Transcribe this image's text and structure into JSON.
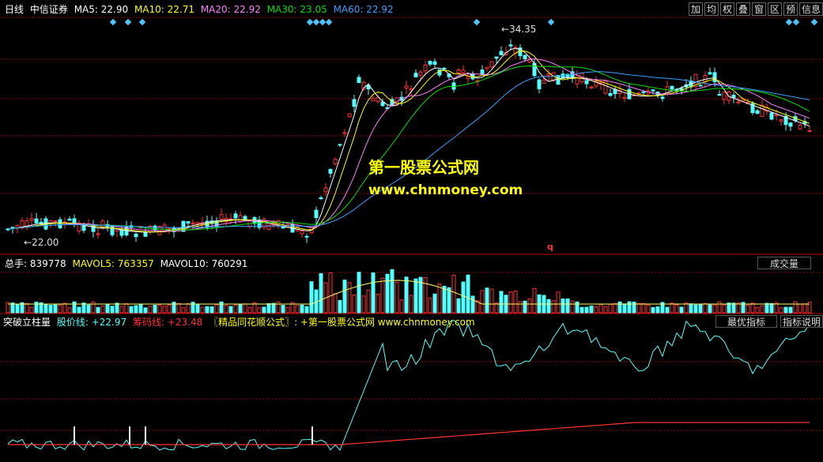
{
  "header": {
    "period": "日线",
    "stock": "中信证券",
    "ma5": "MA5: 22.90",
    "ma10": "MA10: 22.71",
    "ma20": "MA20: 22.92",
    "ma30": "MA30: 23.05",
    "ma60": "MA60: 22.92"
  },
  "toolbar": [
    "加",
    "均",
    "权",
    "叠",
    "窗",
    "区",
    "预",
    "信息"
  ],
  "annotations": {
    "high": "34.35",
    "low": "22.00",
    "marker": "q"
  },
  "watermark": {
    "line1": "第一股票公式网",
    "line2": "www.chnmoney.com"
  },
  "volume_panel": {
    "total": "总手: 839778",
    "mavol5": "MAVOL5: 763357",
    "mavol10": "MAVOL10: 760291",
    "button": "成交量"
  },
  "indicator_panel": {
    "name": "突破立柱量",
    "price_line": "股价线: +22.97",
    "chip_line": "筹码线: +23.48",
    "source": "〖精品同花顺公式〗: +第一股票公式网 www.chnmoney.com",
    "btn_best": "最优指标",
    "btn_desc": "指标说明"
  },
  "colors": {
    "up": "#ff3232",
    "down": "#54ffff",
    "ma5": "#ffffff",
    "ma10": "#ffff00",
    "ma20": "#ff80ff",
    "ma30": "#00e000",
    "ma60": "#3aa0ff",
    "grid": "#8b0000"
  }
}
